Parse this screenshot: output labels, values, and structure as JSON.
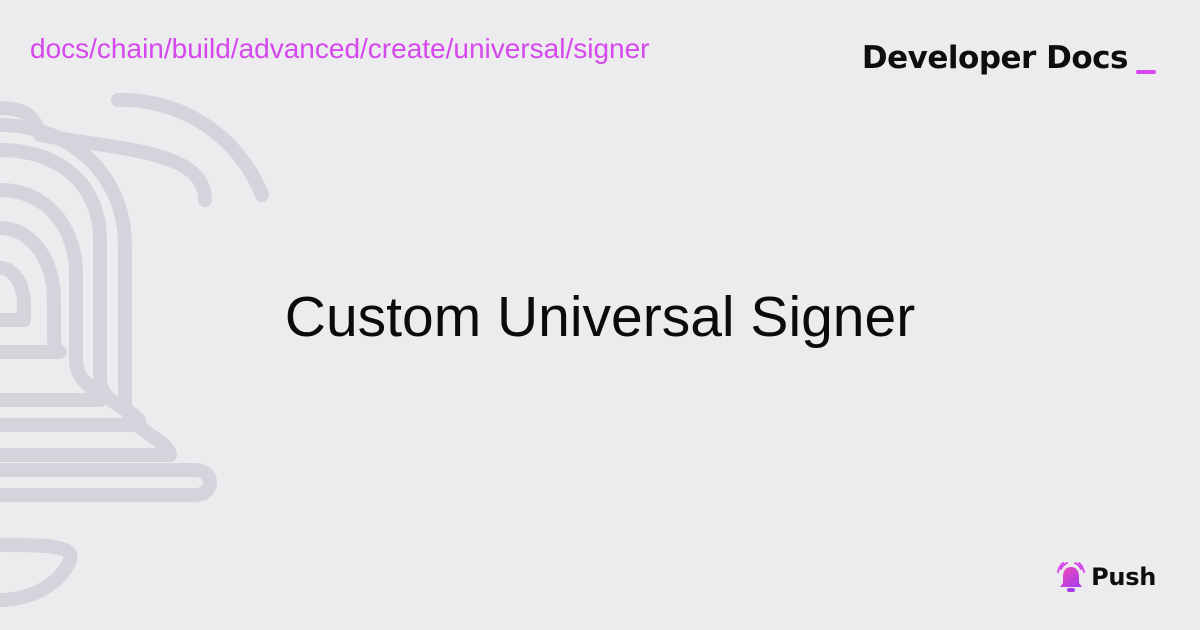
{
  "header": {
    "breadcrumb": "docs/chain/build/advanced/create/universal/signer",
    "brand_title": "Developer Docs"
  },
  "main": {
    "title": "Custom Universal Signer"
  },
  "footer": {
    "logo_text": "Push",
    "logo_icon": "bell-icon"
  },
  "colors": {
    "background": "#ececee",
    "accent": "#d548ec",
    "text": "#0b0b0b",
    "decoration_stroke": "#d4d4dc"
  }
}
